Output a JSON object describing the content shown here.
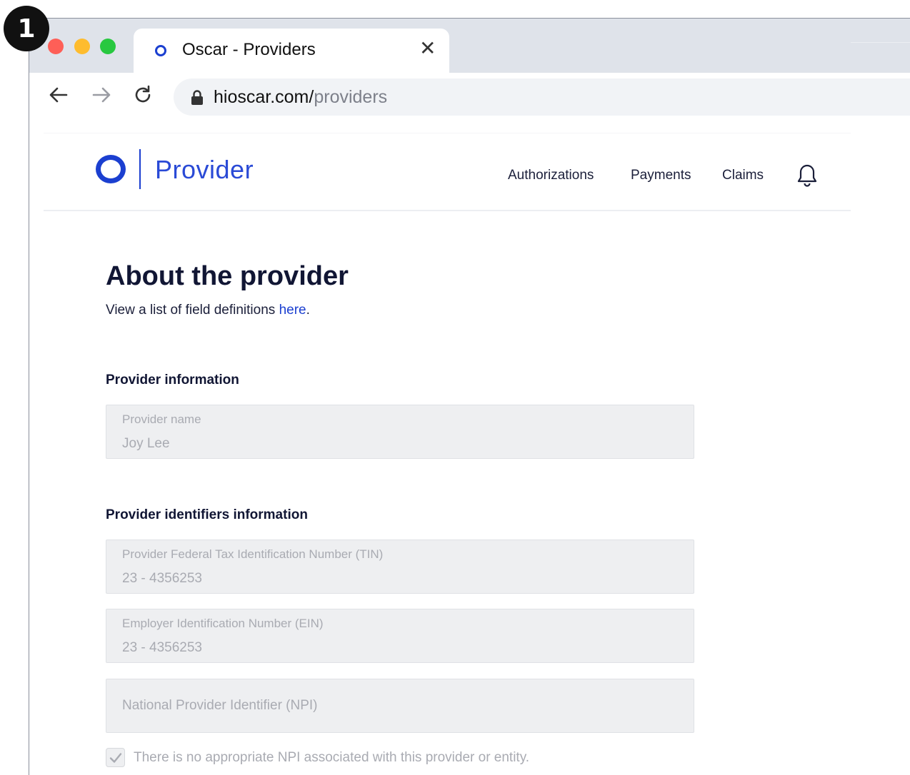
{
  "step": {
    "number": "1"
  },
  "browser": {
    "tab_title": "Oscar - Providers",
    "tab_close": "✕",
    "url_host": "hioscar.com/",
    "url_path": "providers"
  },
  "header": {
    "logo_text": "Provider",
    "nav": [
      "Authorizations",
      "Payments",
      "Claims"
    ]
  },
  "main": {
    "title": "About the provider",
    "subtitle_prefix": "View a list of field definitions ",
    "subtitle_link": "here",
    "subtitle_suffix": ".",
    "sections": [
      {
        "title": "Provider information"
      },
      {
        "title": "Provider identifiers information"
      }
    ],
    "fields": {
      "provider_name": {
        "label": "Provider name",
        "value": "Joy Lee"
      },
      "tin": {
        "label": "Provider Federal Tax Identification Number (TIN)",
        "value": "23 - 4356253"
      },
      "ein": {
        "label": "Employer Identification Number (EIN)",
        "value": "23 - 4356253"
      },
      "npi": {
        "placeholder": "National Provider Identifier (NPI)"
      }
    },
    "npi_checkbox": {
      "label": "There is no appropriate NPI associated with this provider or entity.",
      "checked": true
    }
  },
  "colors": {
    "brand": "#1b3fd0",
    "field_bg": "#eeeff1",
    "muted_text": "#a9abb2"
  }
}
